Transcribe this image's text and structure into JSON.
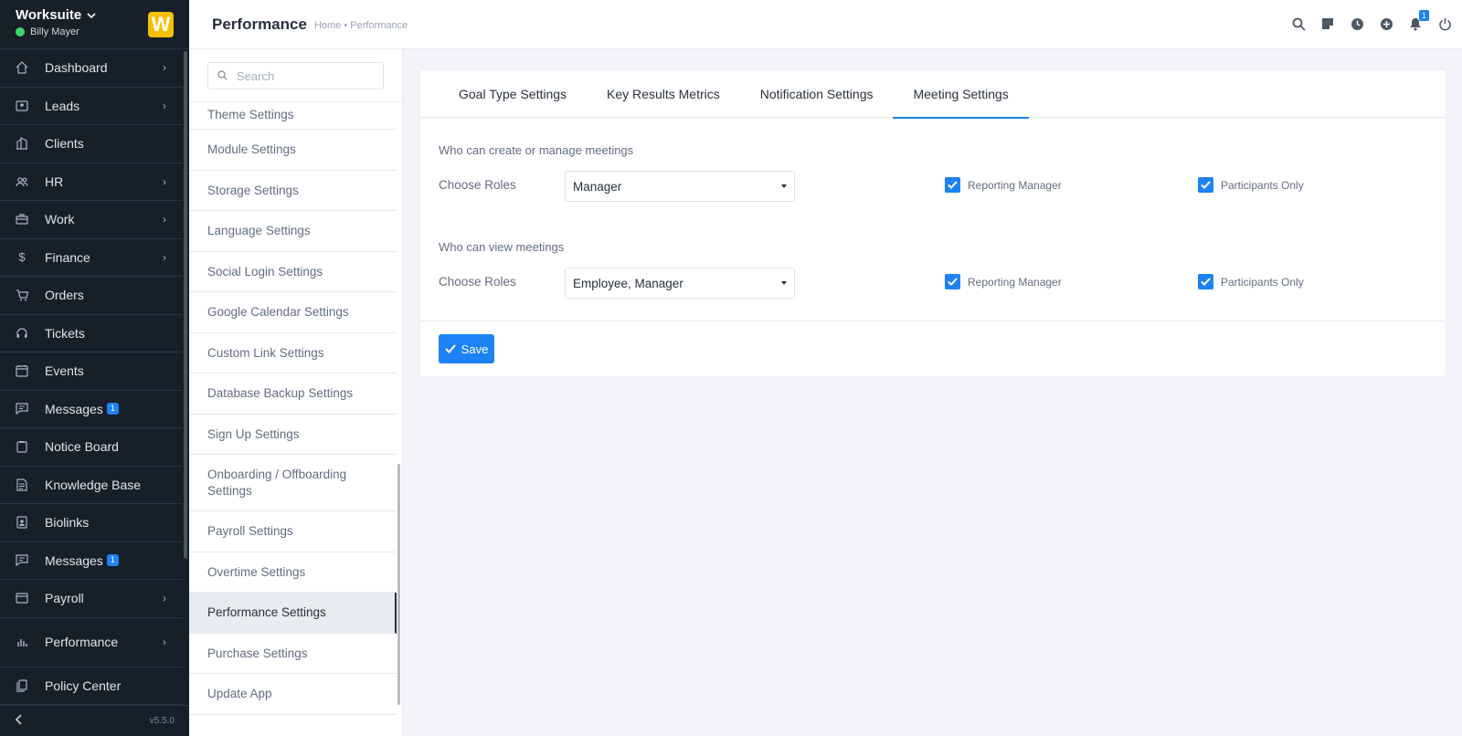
{
  "brand": {
    "name": "Worksuite",
    "user": "Billy Mayer",
    "logo_letter": "W",
    "version": "v5.5.0"
  },
  "sidebar": {
    "items": [
      {
        "label": "Dashboard",
        "icon": "house-icon",
        "chevron": true,
        "badge": ""
      },
      {
        "label": "Leads",
        "icon": "contact-card-icon",
        "chevron": true,
        "badge": ""
      },
      {
        "label": "Clients",
        "icon": "building-icon",
        "chevron": false,
        "badge": ""
      },
      {
        "label": "HR",
        "icon": "people-icon",
        "chevron": true,
        "badge": ""
      },
      {
        "label": "Work",
        "icon": "briefcase-icon",
        "chevron": true,
        "badge": ""
      },
      {
        "label": "Finance",
        "icon": "dollar-icon",
        "chevron": true,
        "badge": ""
      },
      {
        "label": "Orders",
        "icon": "cart-icon",
        "chevron": false,
        "badge": ""
      },
      {
        "label": "Tickets",
        "icon": "headset-icon",
        "chevron": false,
        "badge": ""
      },
      {
        "label": "Events",
        "icon": "calendar-icon",
        "chevron": false,
        "badge": ""
      },
      {
        "label": "Messages",
        "icon": "chat-icon",
        "chevron": false,
        "badge": "1"
      },
      {
        "label": "Notice Board",
        "icon": "clipboard-icon",
        "chevron": false,
        "badge": ""
      },
      {
        "label": "Knowledge Base",
        "icon": "document-icon",
        "chevron": false,
        "badge": ""
      },
      {
        "label": "Biolinks",
        "icon": "id-badge-icon",
        "chevron": false,
        "badge": ""
      },
      {
        "label": "Messages",
        "icon": "chat-icon",
        "chevron": false,
        "badge": "1"
      },
      {
        "label": "Payroll",
        "icon": "wallet-icon",
        "chevron": true,
        "badge": ""
      },
      {
        "label": "Performance",
        "icon": "bar-chart-icon",
        "chevron": true,
        "badge": ""
      },
      {
        "label": "Policy Center",
        "icon": "files-icon",
        "chevron": false,
        "badge": ""
      }
    ]
  },
  "header": {
    "title": "Performance",
    "breadcrumb": "Home • Performance",
    "notification_count": "1"
  },
  "subnav": {
    "search_placeholder": "Search",
    "items": [
      "Theme Settings",
      "Module Settings",
      "Storage Settings",
      "Language Settings",
      "Social Login Settings",
      "Google Calendar Settings",
      "Custom Link Settings",
      "Database Backup Settings",
      "Sign Up Settings",
      "Onboarding / Offboarding Settings",
      "Payroll Settings",
      "Overtime Settings",
      "Performance Settings",
      "Purchase Settings",
      "Update App"
    ],
    "active_index": 12
  },
  "tabs": [
    {
      "label": "Goal Type Settings",
      "active": false
    },
    {
      "label": "Key Results Metrics",
      "active": false
    },
    {
      "label": "Notification Settings",
      "active": false
    },
    {
      "label": "Meeting Settings",
      "active": true
    }
  ],
  "sections": [
    {
      "title": "Who can create or manage meetings",
      "roles_label": "Choose Roles",
      "roles_value": "Manager",
      "checkbox1": "Reporting Manager",
      "checkbox2": "Participants Only"
    },
    {
      "title": "Who can view meetings",
      "roles_label": "Choose Roles",
      "roles_value": "Employee, Manager",
      "checkbox1": "Reporting Manager",
      "checkbox2": "Participants Only"
    }
  ],
  "save_label": "Save",
  "colors": {
    "accent": "#1d82f5",
    "sidebar_bg": "#171f29",
    "logo": "#f6c002",
    "online": "#39d86a"
  }
}
